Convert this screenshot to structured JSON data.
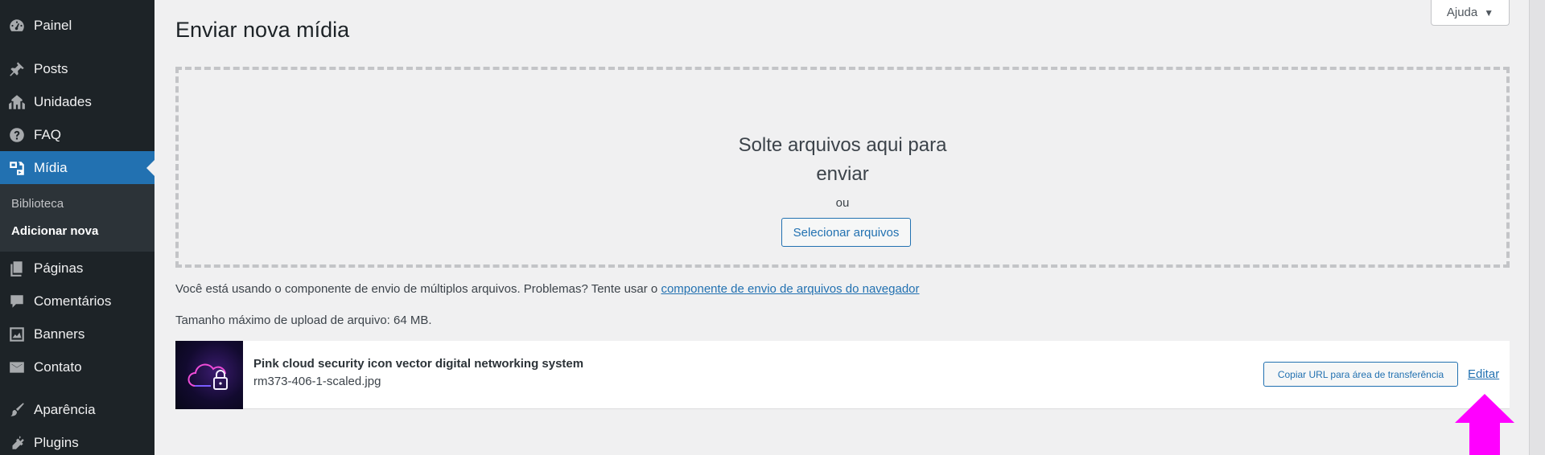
{
  "sidebar": {
    "items": [
      {
        "label": "Painel",
        "icon": "dashboard-icon"
      },
      {
        "label": "Posts",
        "icon": "pin-icon"
      },
      {
        "label": "Unidades",
        "icon": "buildings-icon"
      },
      {
        "label": "FAQ",
        "icon": "question-icon"
      },
      {
        "label": "Mídia",
        "icon": "media-icon",
        "active": true
      },
      {
        "label": "Páginas",
        "icon": "pages-icon"
      },
      {
        "label": "Comentários",
        "icon": "comment-icon"
      },
      {
        "label": "Banners",
        "icon": "image-gallery-icon"
      },
      {
        "label": "Contato",
        "icon": "envelope-icon"
      },
      {
        "label": "Aparência",
        "icon": "brush-icon"
      },
      {
        "label": "Plugins",
        "icon": "plug-icon"
      }
    ],
    "submenu": [
      {
        "label": "Biblioteca"
      },
      {
        "label": "Adicionar nova",
        "current": true
      }
    ]
  },
  "header": {
    "help_label": "Ajuda",
    "page_title": "Enviar nova mídia"
  },
  "uploader": {
    "drop_title": "Solte arquivos aqui para enviar",
    "or_label": "ou",
    "select_label": "Selecionar arquivos",
    "multi_note": "Você está usando o componente de envio de múltiplos arquivos. Problemas? Tente usar o",
    "browser_uploader_link": "componente de envio de arquivos do navegador",
    "max_size": "Tamanho máximo de upload de arquivo: 64 MB."
  },
  "media_item": {
    "title": "Pink cloud security icon vector digital networking system",
    "filename": "rm373-406-1-scaled.jpg",
    "copy_url_label": "Copiar URL para área de transferência",
    "edit_label": "Editar"
  },
  "colors": {
    "sidebar_bg": "#1d2327",
    "accent": "#2271b1",
    "annotation_arrow": "#ff00ff"
  }
}
